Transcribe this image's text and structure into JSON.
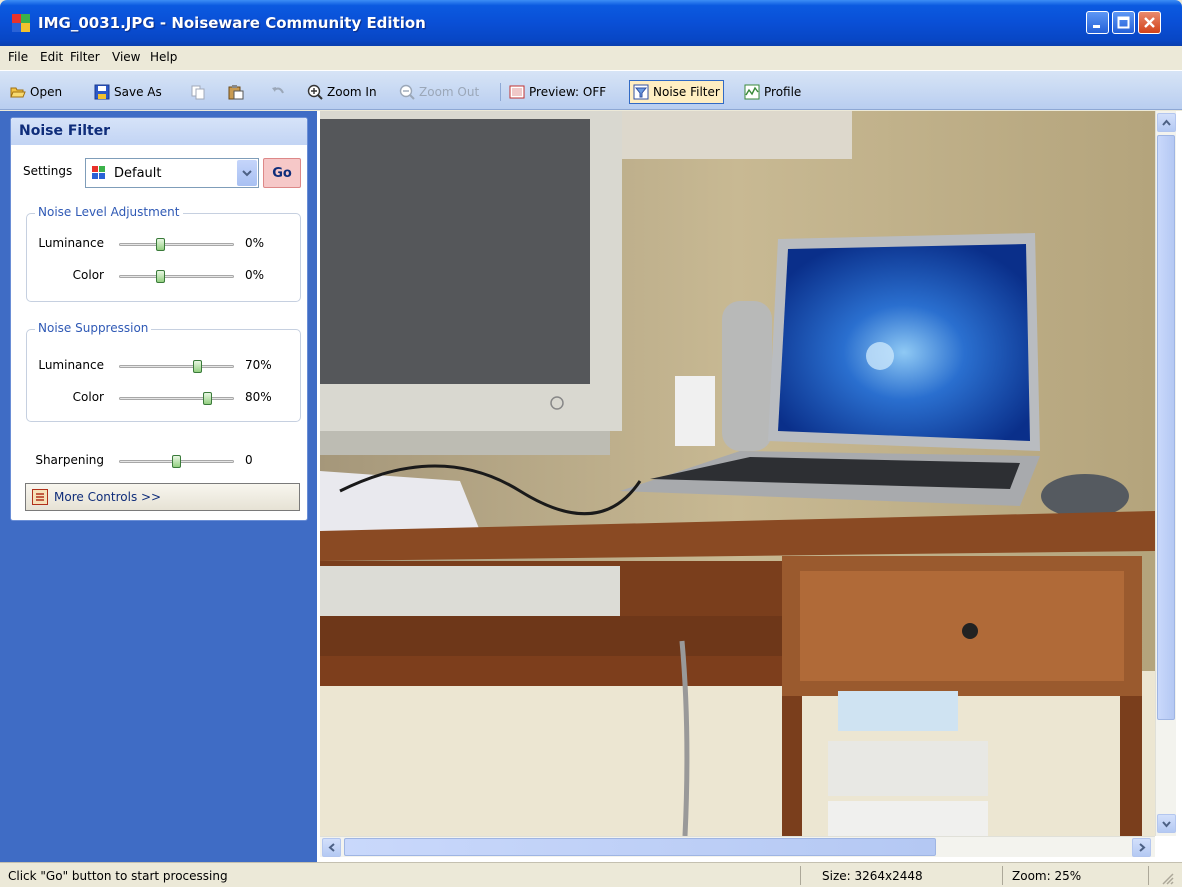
{
  "window": {
    "title": "IMG_0031.JPG - Noiseware Community Edition"
  },
  "menu": [
    "File",
    "Edit",
    "Filter",
    "View",
    "Help"
  ],
  "toolbar": {
    "open": "Open",
    "save_as": "Save As",
    "zoom_in": "Zoom In",
    "zoom_out": "Zoom Out",
    "preview": "Preview: OFF",
    "noise_filter": "Noise Filter",
    "profile": "Profile"
  },
  "panel": {
    "title": "Noise Filter",
    "settings_label": "Settings",
    "settings_value": "Default",
    "go": "Go",
    "noise_level": {
      "title": "Noise Level Adjustment",
      "luminance": {
        "label": "Luminance",
        "value": "0%",
        "level": 0.35
      },
      "color": {
        "label": "Color",
        "value": "0%",
        "level": 0.35
      }
    },
    "noise_suppression": {
      "title": "Noise Suppression",
      "luminance": {
        "label": "Luminance",
        "value": "70%",
        "level": 0.7
      },
      "color": {
        "label": "Color",
        "value": "80%",
        "level": 0.8
      }
    },
    "sharpening": {
      "label": "Sharpening",
      "value": "0",
      "level": 0.5
    },
    "more_controls": "More Controls >>"
  },
  "status": {
    "message": "Click \"Go\" button to start processing",
    "size": "Size: 3264x2448",
    "zoom": "Zoom: 25%"
  },
  "colors": {
    "accent": "#3f6cc5",
    "title_bar": "#0a4fd6",
    "pressed": "#ffeec2"
  }
}
